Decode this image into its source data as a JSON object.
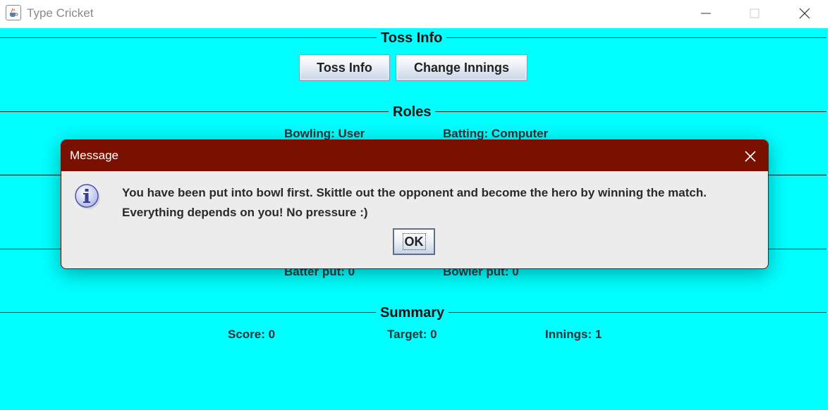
{
  "window": {
    "title": "Type Cricket",
    "icon": "java-cup-icon",
    "controls": [
      "minimize-icon",
      "maximize-icon",
      "close-icon"
    ]
  },
  "toss_section": {
    "title": "Toss Info",
    "toss_info_button": "Toss Info",
    "change_innings_button": "Change Innings"
  },
  "roles_section": {
    "title": "Roles",
    "bowling": "Bowling: User",
    "batting": "Batting: Computer"
  },
  "put_section": {
    "batter_put": "Batter put: 0",
    "bowler_put": "Bowler put: 0"
  },
  "summary_section": {
    "title": "Summary",
    "score": "Score: 0",
    "target": "Target: 0",
    "innings": "Innings: 1"
  },
  "dialog": {
    "title": "Message",
    "icon": "info-icon",
    "message_line1": "You have been put into bowl first. Skittle out the opponent and become the hero by winning the match.",
    "message_line2": "Everything depends on you! No pressure :)",
    "ok_label": "OK"
  },
  "colors": {
    "background": "#00ffff",
    "dialog_header": "#7a1000",
    "dialog_body": "#ececec"
  }
}
